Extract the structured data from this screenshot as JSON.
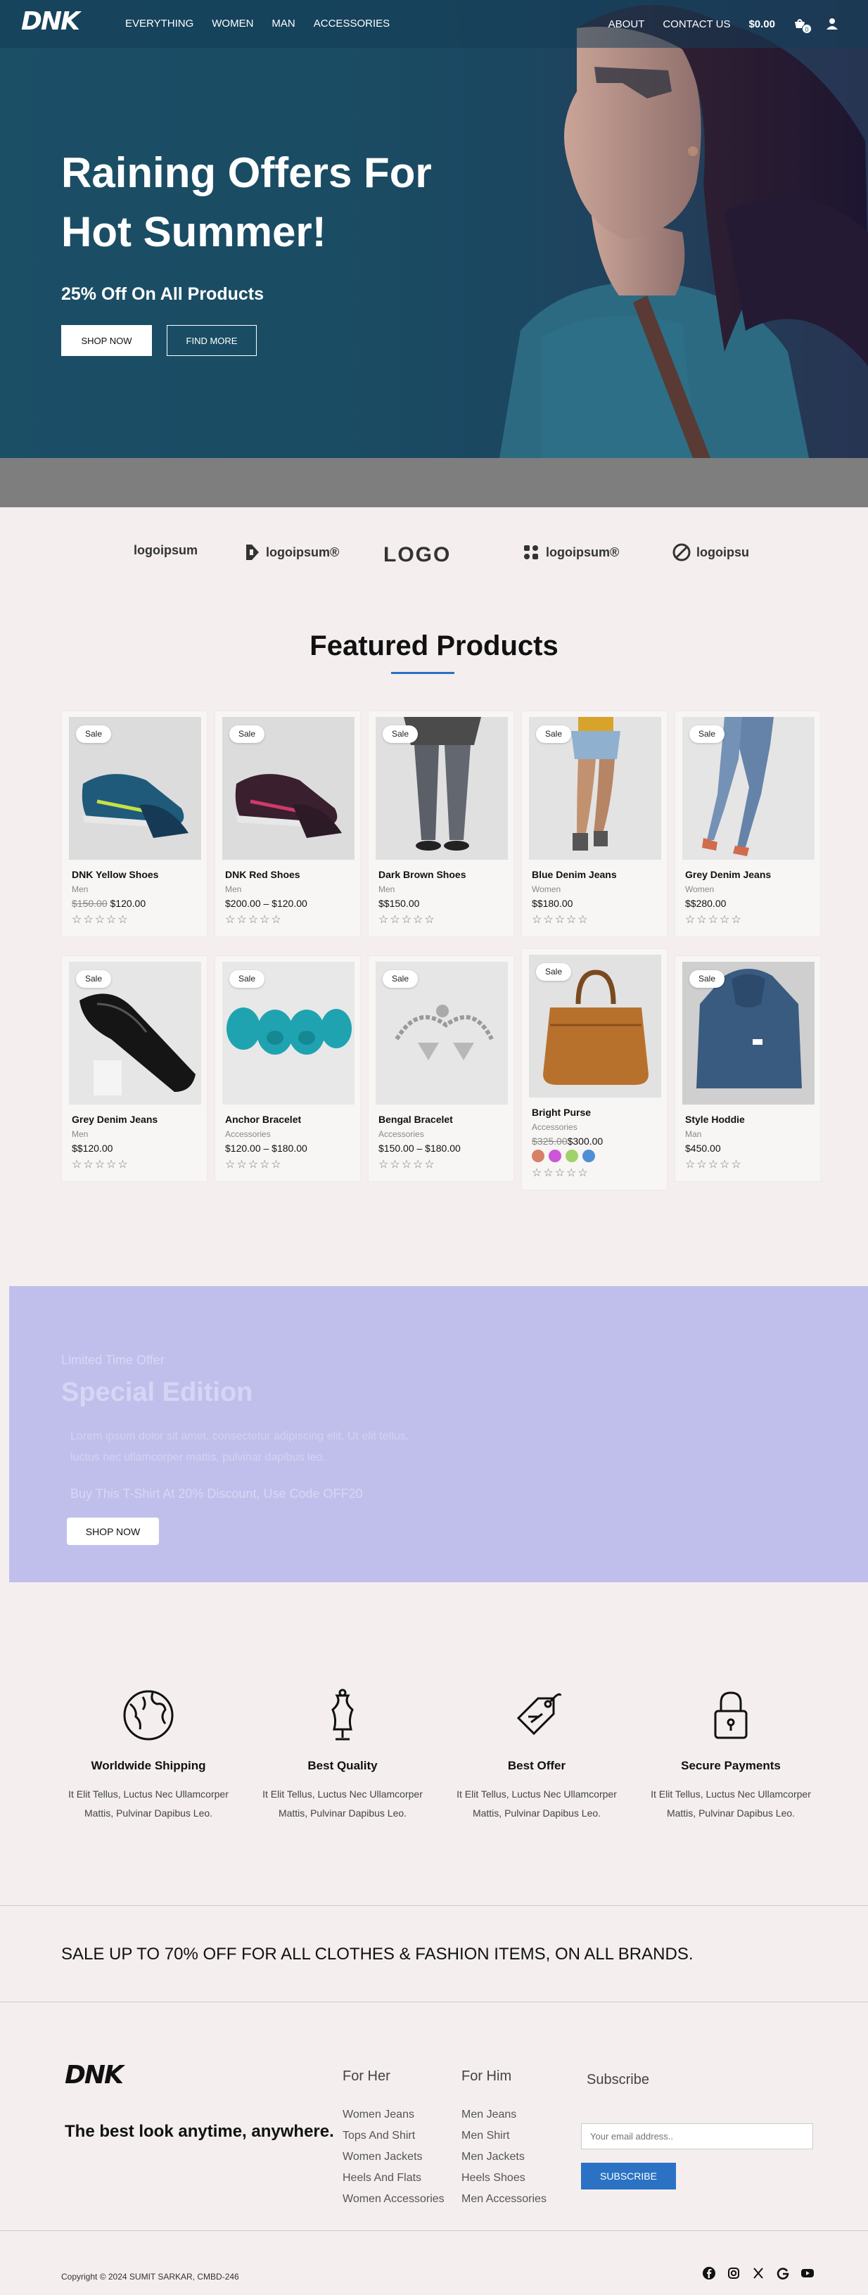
{
  "nav": {
    "logo": "DNK",
    "links": [
      "EVERYTHING",
      "WOMEN",
      "MAN",
      "ACCESSORIES"
    ],
    "right_links": [
      "ABOUT",
      "CONTACT US"
    ],
    "cart_total": "$0.00",
    "cart_count": "0"
  },
  "hero": {
    "title": "Raining Offers For Hot Summer!",
    "subtitle": "25% Off On All Products",
    "shop_now": "SHOP NOW",
    "find_more": "FIND MORE"
  },
  "brand_logos": [
    "logoipsum",
    "logoipsum®",
    "LOGO",
    "logoipsum®",
    "logoipsu"
  ],
  "featured": {
    "title": "Featured Products",
    "products": [
      {
        "name": "DNK Yellow Shoes",
        "category": "Men",
        "old_price": "$150.00",
        "price": "$120.00",
        "sale": "Sale"
      },
      {
        "name": "DNK Red Shoes",
        "category": "Men",
        "old_price": "",
        "price": "$200.00 – $120.00",
        "sale": "Sale"
      },
      {
        "name": "Dark Brown Shoes",
        "category": "Men",
        "old_price": "",
        "price": "$$150.00",
        "sale": "Sale"
      },
      {
        "name": "Blue Denim Jeans",
        "category": "Women",
        "old_price": "",
        "price": "$$180.00",
        "sale": "Sale"
      },
      {
        "name": "Grey Denim Jeans",
        "category": "Women",
        "old_price": "",
        "price": "$$280.00",
        "sale": "Sale"
      },
      {
        "name": "Grey Denim Jeans",
        "category": "Men",
        "old_price": "",
        "price": "$$120.00",
        "sale": "Sale"
      },
      {
        "name": "Anchor Bracelet",
        "category": "Accessories",
        "old_price": "",
        "price": "$120.00 – $180.00",
        "sale": "Sale"
      },
      {
        "name": "Bengal Bracelet",
        "category": "Accessories",
        "old_price": "",
        "price": "$150.00 – $180.00",
        "sale": "Sale"
      },
      {
        "name": "Bright Purse",
        "category": "Accessories",
        "old_price": "$325.00",
        "price": "$300.00",
        "sale": "Sale"
      },
      {
        "name": "Style Hoddie",
        "category": "Man",
        "old_price": "",
        "price": "$450.00",
        "sale": "Sale"
      }
    ],
    "rating_stars": "☆☆☆☆☆",
    "purse_swatches": [
      "#d7806a",
      "#cc55d8",
      "#9fd36a",
      "#4f8fd6"
    ]
  },
  "special": {
    "kicker": "Limited Time Offer",
    "title": "Special Edition",
    "description": "Lorem ipsum dolor sit amet, consectetur adipiscing elit. Ut elit tellus, luctus nec ullamcorper mattis, pulvinar dapibus leo.",
    "offer": "Buy This T-Shirt At 20% Discount, Use Code OFF20",
    "button": "SHOP NOW"
  },
  "features": [
    {
      "title": "Worldwide Shipping",
      "desc": "It Elit Tellus, Luctus Nec Ullamcorper Mattis, Pulvinar Dapibus Leo."
    },
    {
      "title": "Best Quality",
      "desc": "It Elit Tellus, Luctus Nec Ullamcorper Mattis, Pulvinar Dapibus Leo."
    },
    {
      "title": "Best Offer",
      "desc": "It Elit Tellus, Luctus Nec Ullamcorper Mattis, Pulvinar Dapibus Leo."
    },
    {
      "title": "Secure Payments",
      "desc": "It Elit Tellus, Luctus Nec Ullamcorper Mattis, Pulvinar Dapibus Leo."
    }
  ],
  "sale_strip": "SALE UP TO 70% OFF FOR ALL CLOTHES & FASHION ITEMS, ON ALL BRANDS.",
  "footer": {
    "logo": "DNK",
    "tagline": "The best look anytime, anywhere.",
    "for_her": {
      "title": "For Her",
      "links": [
        "Women Jeans",
        "Tops And Shirt",
        "Women Jackets",
        "Heels And Flats",
        "Women Accessories"
      ]
    },
    "for_him": {
      "title": "For Him",
      "links": [
        "Men Jeans",
        "Men Shirt",
        "Men Jackets",
        "Heels Shoes",
        "Men Accessories"
      ]
    },
    "subscribe_title": "Subscribe",
    "email_placeholder": "Your email address..",
    "subscribe_button": "SUBSCRIBE",
    "copyright": "Copyright © 2024 SUMIT SARKAR, CMBD-246",
    "socials": [
      "facebook-icon",
      "instagram-icon",
      "x-icon",
      "google-icon",
      "youtube-icon"
    ]
  }
}
